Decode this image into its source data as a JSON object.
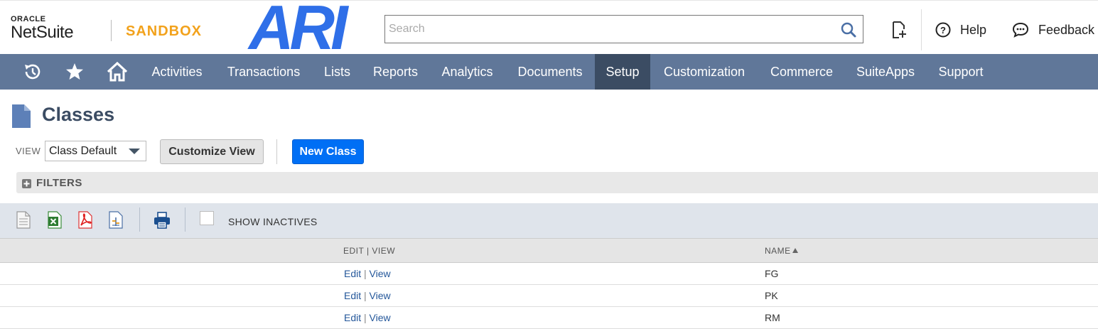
{
  "header": {
    "oracle": "ORACLE",
    "netsuite": "NetSuite",
    "environment": "SANDBOX",
    "brand": "ARI",
    "search_placeholder": "Search",
    "help_label": "Help",
    "feedback_label": "Feedback"
  },
  "nav": {
    "icons": [
      "recent-records-icon",
      "star-icon",
      "home-icon"
    ],
    "items": [
      {
        "label": "Activities"
      },
      {
        "label": "Transactions"
      },
      {
        "label": "Lists"
      },
      {
        "label": "Reports"
      },
      {
        "label": "Analytics"
      },
      {
        "label": "Documents"
      },
      {
        "label": "Setup",
        "active": true
      },
      {
        "label": "Customization"
      },
      {
        "label": "Commerce"
      },
      {
        "label": "SuiteApps"
      },
      {
        "label": "Support"
      }
    ]
  },
  "page": {
    "title": "Classes"
  },
  "view": {
    "label": "VIEW",
    "selected": "Class Default",
    "customize_label": "Customize View",
    "new_label": "New Class"
  },
  "filters": {
    "label": "FILTERS"
  },
  "toolbar": {
    "show_inactives_label": "SHOW INACTIVES",
    "show_inactives_checked": false
  },
  "table": {
    "columns": [
      "EDIT | VIEW",
      "NAME"
    ],
    "sort_column": "NAME",
    "rows": [
      {
        "edit": "Edit",
        "sep": "|",
        "view": "View",
        "name": "FG"
      },
      {
        "edit": "Edit",
        "sep": "|",
        "view": "View",
        "name": "PK"
      },
      {
        "edit": "Edit",
        "sep": "|",
        "view": "View",
        "name": "RM"
      }
    ]
  },
  "colors": {
    "nav_bg": "#607799",
    "nav_active": "#3b4c63",
    "primary_button": "#006ff5",
    "sandbox": "#f2a21c",
    "brand": "#2f6fe8",
    "link": "#24579a"
  }
}
